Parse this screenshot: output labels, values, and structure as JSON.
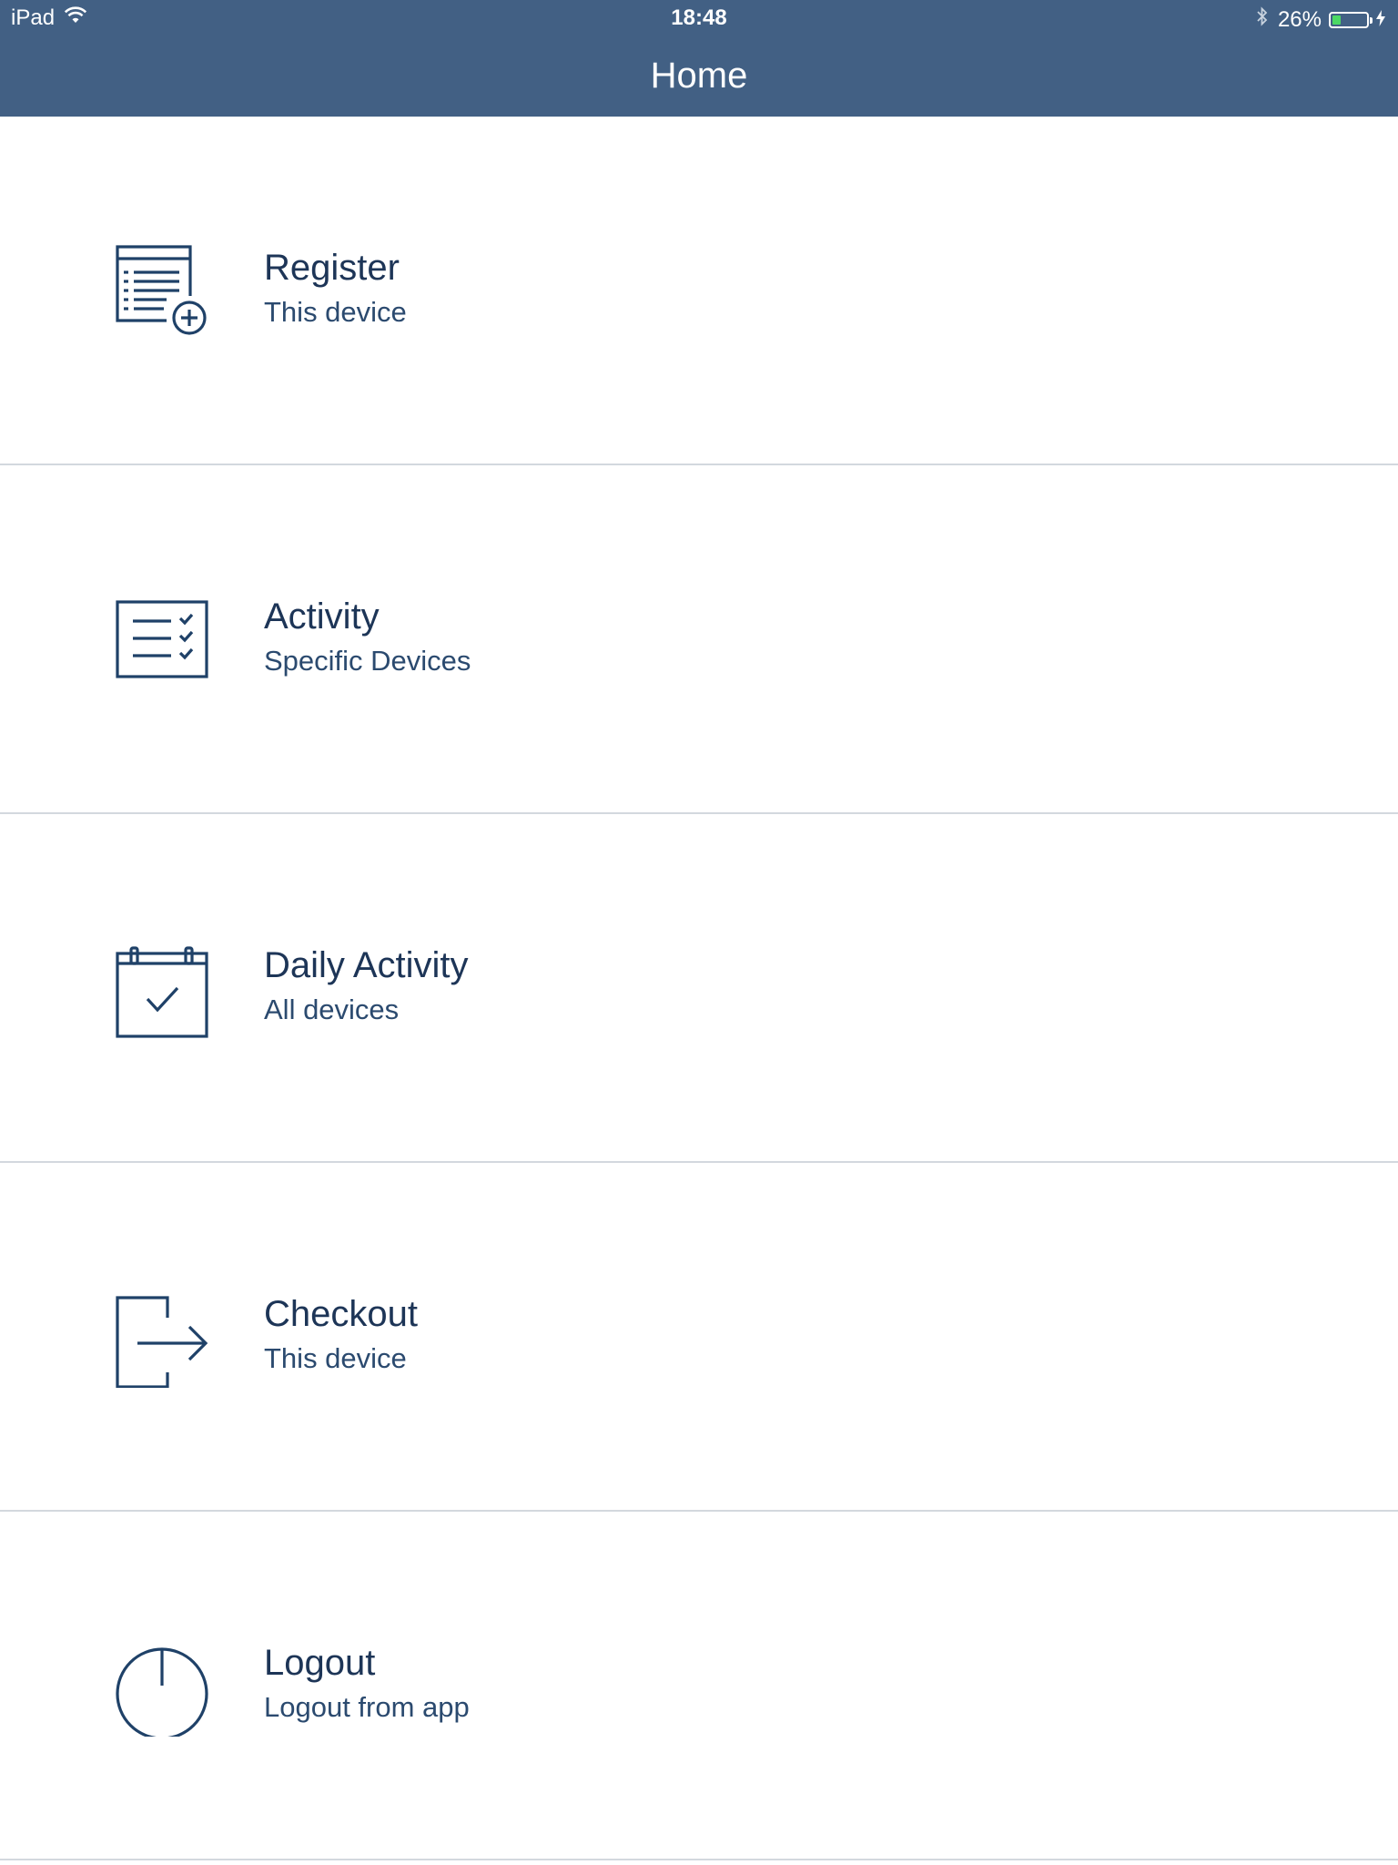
{
  "status_bar": {
    "device": "iPad",
    "time": "18:48",
    "battery_label": "26%",
    "battery_level": 0.26,
    "wifi_icon": "wifi-icon",
    "bluetooth_icon": "bluetooth-icon",
    "charging_icon": "charging-bolt-icon"
  },
  "header": {
    "title": "Home",
    "background": "#426084"
  },
  "menu": {
    "items": [
      {
        "icon": "register-form-add-icon",
        "title": "Register",
        "subtitle": "This device"
      },
      {
        "icon": "checklist-icon",
        "title": "Activity",
        "subtitle": "Specific Devices"
      },
      {
        "icon": "calendar-check-icon",
        "title": "Daily Activity",
        "subtitle": "All devices"
      },
      {
        "icon": "exit-arrow-icon",
        "title": "Checkout",
        "subtitle": "This device"
      },
      {
        "icon": "power-icon",
        "title": "Logout",
        "subtitle": "Logout from app"
      }
    ],
    "icon_color": "#1f4168",
    "text_color": "#1d3557",
    "divider_color": "#d3d8de"
  }
}
